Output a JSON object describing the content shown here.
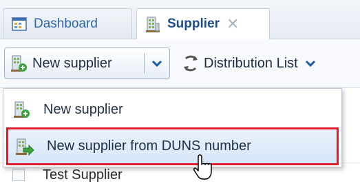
{
  "tabs": [
    {
      "label": "Dashboard",
      "icon": "dashboard-icon",
      "active": false
    },
    {
      "label": "Supplier",
      "icon": "supplier-icon",
      "active": true,
      "closable": true
    }
  ],
  "toolbar": {
    "new_supplier_label": "New supplier",
    "distribution_list_label": "Distribution List"
  },
  "menu": {
    "items": [
      {
        "label": "New supplier",
        "icon": "supplier-add-icon"
      },
      {
        "label": "New supplier from DUNS number",
        "icon": "supplier-import-icon",
        "highlighted": true
      }
    ]
  },
  "grid": {
    "rows": [
      {
        "name": "Test Supplier"
      }
    ]
  },
  "colors": {
    "highlight_border": "#e01e2a",
    "accent": "#1e4d8c"
  }
}
